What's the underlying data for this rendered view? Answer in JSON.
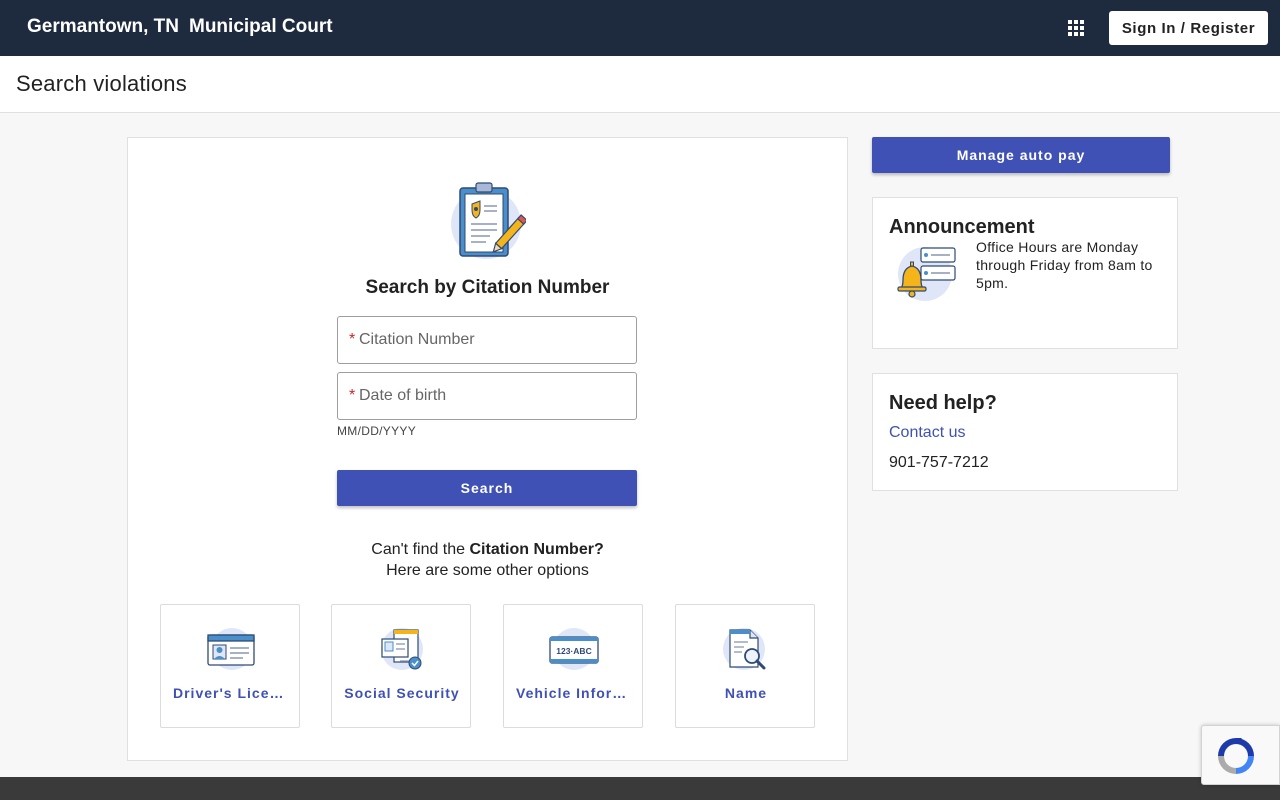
{
  "header": {
    "city": "Germantown, TN",
    "court": "Municipal Court",
    "apps_icon": "grid-apps-icon",
    "signin_label": "Sign In / Register"
  },
  "page": {
    "title": "Search violations"
  },
  "search": {
    "icon": "clipboard-pencil-icon",
    "title": "Search by Citation Number",
    "citation_placeholder": "Citation Number",
    "dob_placeholder": "Date of birth",
    "dob_hint": "MM/DD/YYYY",
    "required_marker": "*",
    "button_label": "Search",
    "cant_find_prefix": "Can't find the ",
    "cant_find_bold": "Citation Number?",
    "other_options": "Here are some other options"
  },
  "options": [
    {
      "label": "Driver's License",
      "icon": "drivers-license-icon"
    },
    {
      "label": "Social Security",
      "icon": "social-security-icon"
    },
    {
      "label": "Vehicle Information",
      "icon": "vehicle-plate-icon"
    },
    {
      "label": "Name",
      "icon": "name-search-icon"
    }
  ],
  "sidebar": {
    "autopay_label": "Manage auto pay",
    "announcement": {
      "title": "Announcement",
      "icon": "bell-icon",
      "text": "Office Hours are Monday through Friday from 8am to 5pm."
    },
    "help": {
      "title": "Need help?",
      "contact_label": "Contact us",
      "phone": "901-757-7212"
    }
  },
  "colors": {
    "topbar": "#1e2a3e",
    "primary": "#3f51b5",
    "required": "#c62828",
    "footer": "#3a3a3a"
  }
}
